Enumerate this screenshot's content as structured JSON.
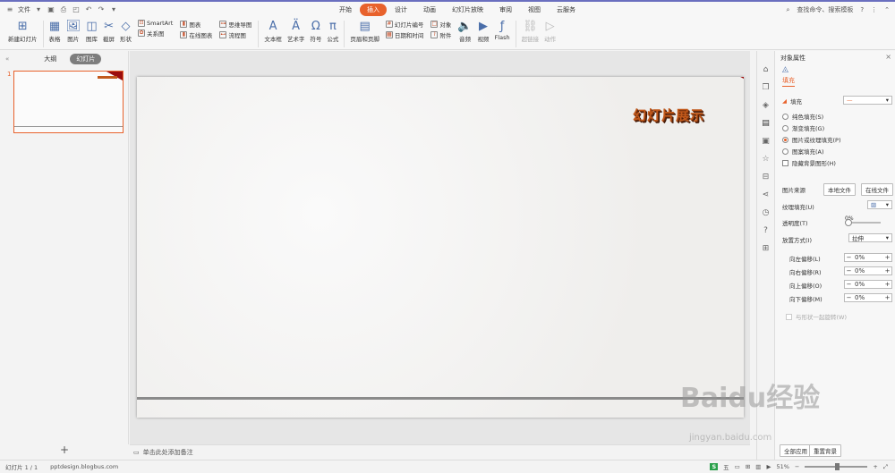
{
  "titlebar": {
    "file_menu": "文件",
    "tabs": [
      "开始",
      "插入",
      "设计",
      "动画",
      "幻灯片放映",
      "审阅",
      "视图",
      "云服务"
    ],
    "active_tab": "插入",
    "search": "查找命令、搜索模板",
    "help": "?"
  },
  "ribbon": {
    "new_slide": "新建幻灯片",
    "table": "表格",
    "picture": "图片",
    "gallery": "图库",
    "screenshot": "截屏",
    "shape": "形状",
    "smartart": "SmartArt",
    "relation": "关系图",
    "chart": "图表",
    "online_chart": "在线图表",
    "mindmap": "思维导图",
    "flowchart": "流程图",
    "textbox": "文本框",
    "wordart": "艺术字",
    "symbol": "符号",
    "formula": "公式",
    "header_footer": "页眉和页脚",
    "slide_number": "幻灯片编号",
    "datetime": "日期和时间",
    "object": "对象",
    "attachment": "附件",
    "audio": "音频",
    "video": "视频",
    "flash": "Flash",
    "hyperlink": "超链接",
    "action": "动作"
  },
  "left_pane": {
    "tabs": [
      "大纲",
      "幻灯片"
    ],
    "active_tab": "幻灯片",
    "slide_number": "1",
    "add_label": "+"
  },
  "slide": {
    "title_text": "幻灯片展示"
  },
  "notes": {
    "placeholder": "单击此处添加备注"
  },
  "right_pane": {
    "title": "对象属性",
    "fill_tab": "填充",
    "fill_section": "填充",
    "options": [
      "纯色填充(S)",
      "渐变填充(G)",
      "图片或纹理填充(P)",
      "图案填充(A)"
    ],
    "selected_option": "图片或纹理填充(P)",
    "hide_bg": "隐藏背景图形(H)",
    "picture_source_label": "图片来源",
    "local_file": "本地文件",
    "online_file": "在线文件",
    "texture_label": "纹理填充(U)",
    "transparency_label": "透明度(T)",
    "transparency_value": "0%",
    "placement_label": "放置方式(I)",
    "placement_value": "拉伸",
    "offsets": [
      {
        "label": "向左偏移(L)",
        "value": "0%"
      },
      {
        "label": "向右偏移(R)",
        "value": "0%"
      },
      {
        "label": "向上偏移(O)",
        "value": "0%"
      },
      {
        "label": "向下偏移(M)",
        "value": "0%"
      }
    ],
    "rotate_with_shape": "与形状一起旋转(W)",
    "apply_all": "全部应用",
    "reset_bg": "重置背景"
  },
  "statusbar": {
    "slide_count": "幻灯片 1 / 1",
    "author": "pptdesign.blogbus.com",
    "zoom": "51%"
  },
  "watermark": {
    "text": "Baidu经验",
    "url": "jingyan.baidu.com"
  }
}
